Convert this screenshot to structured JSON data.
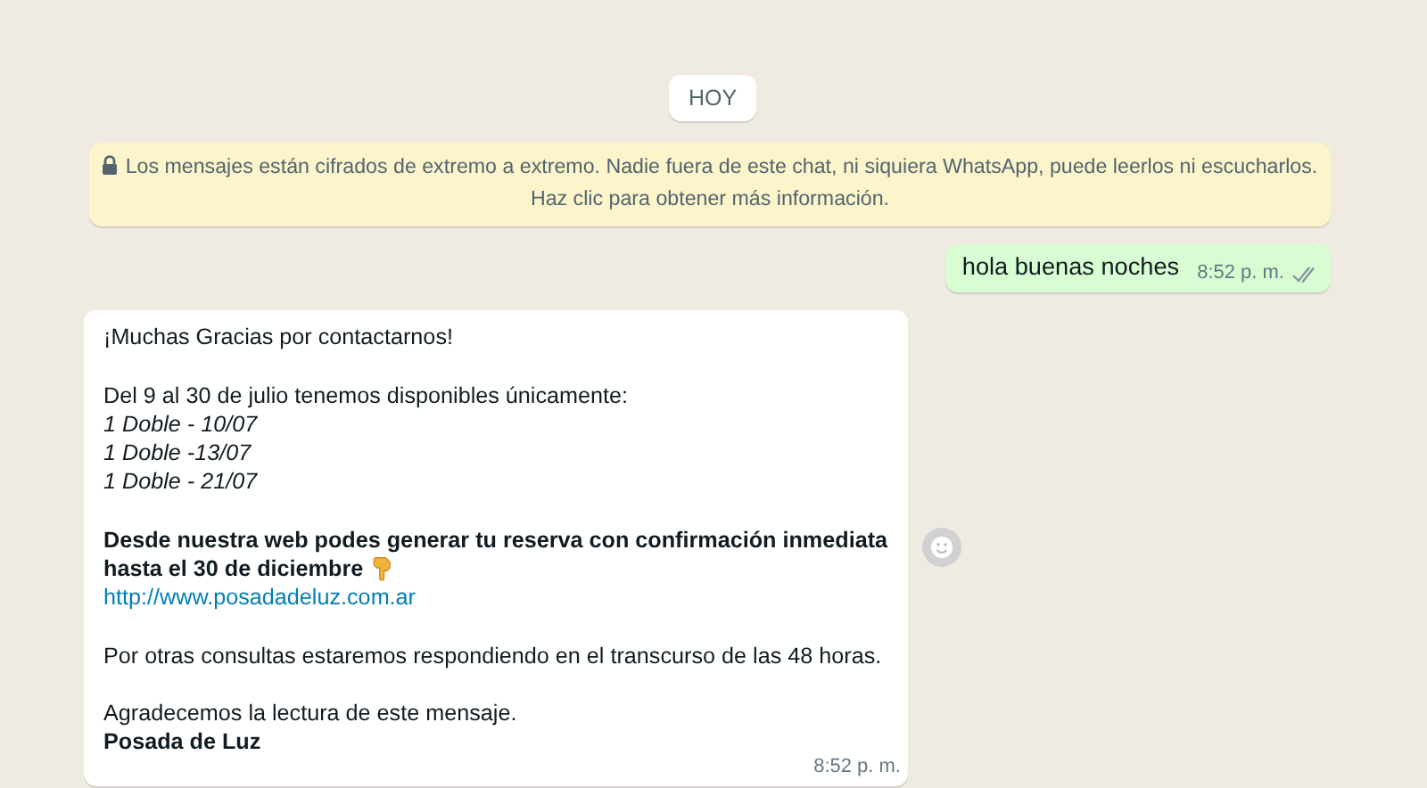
{
  "date_chip": "HOY",
  "encryption_notice": {
    "text": "Los mensajes están cifrados de extremo a extremo. Nadie fuera de este chat, ni siquiera WhatsApp, puede leerlos ni escucharlos.",
    "link_text": "Haz clic para obtener más información."
  },
  "messages": [
    {
      "kind": "outgoing",
      "delivered": true,
      "time": "8:52 p. m.",
      "paragraphs": [
        [
          {
            "kind": "plain",
            "text": "hola buenas noches"
          }
        ]
      ]
    },
    {
      "kind": "incoming",
      "time": "8:52 p. m.",
      "paragraphs": [
        [
          {
            "kind": "plain",
            "text": "¡Muchas Gracias por contactarnos!"
          }
        ],
        [
          {
            "kind": "plain",
            "text": "Del 9 al 30 de julio tenemos disponibles únicamente:"
          },
          {
            "kind": "italic",
            "text": "1 Doble - 10/07"
          },
          {
            "kind": "italic",
            "text": "1 Doble -13/07"
          },
          {
            "kind": "italic",
            "text": "1 Doble - 21/07"
          }
        ],
        [
          {
            "kind": "bold",
            "text": "Desde nuestra web podes generar tu reserva con confirmación inmediata hasta el 30 de diciembre",
            "pointing_hand": true
          },
          {
            "kind": "link",
            "text": "http://www.posadadeluz.com.ar"
          }
        ],
        [
          {
            "kind": "plain",
            "text": "Por otras consultas estaremos respondiendo en el transcurso de las 48 horas."
          }
        ],
        [
          {
            "kind": "plain",
            "text": "Agradecemos la lectura de este mensaje."
          },
          {
            "kind": "bold",
            "text": "Posada de Luz"
          }
        ]
      ]
    }
  ]
}
